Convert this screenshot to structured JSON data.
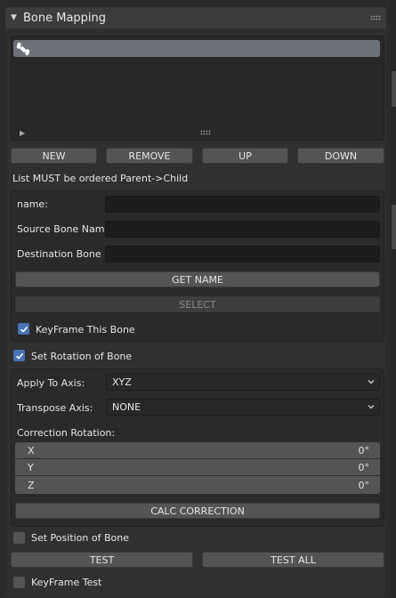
{
  "panel": {
    "title": "Bone Mapping"
  },
  "list_buttons": {
    "new": "NEW",
    "remove": "REMOVE",
    "up": "UP",
    "down": "DOWN"
  },
  "notice": "List MUST be ordered Parent->Child",
  "bone_fields": {
    "name_label": "name:",
    "name_value": "",
    "source_label": "Source Bone Name:",
    "source_value": "",
    "dest_label": "Destination Bone ...",
    "dest_value": "",
    "get_name": "GET NAME",
    "select": "SELECT",
    "keyframe_bone": "KeyFrame This Bone"
  },
  "rotation": {
    "label": "Set Rotation of Bone",
    "apply_axis_label": "Apply To Axis:",
    "apply_axis_value": "XYZ",
    "transpose_label": "Transpose Axis:",
    "transpose_value": "NONE",
    "correction_label": "Correction Rotation:",
    "x_label": "X",
    "x_value": "0°",
    "y_label": "Y",
    "y_value": "0°",
    "z_label": "Z",
    "z_value": "0°",
    "calc": "CALC CORRECTION"
  },
  "position": {
    "label": "Set Position of Bone"
  },
  "tests": {
    "test": "TEST",
    "test_all": "TEST ALL",
    "keyframe_test": "KeyFrame Test"
  },
  "checks": {
    "keyframe_bone": true,
    "set_rotation": true,
    "set_position": false,
    "keyframe_test": false
  },
  "colors": {
    "accent": "#4772b3",
    "panel": "#303030",
    "button": "#545454"
  }
}
